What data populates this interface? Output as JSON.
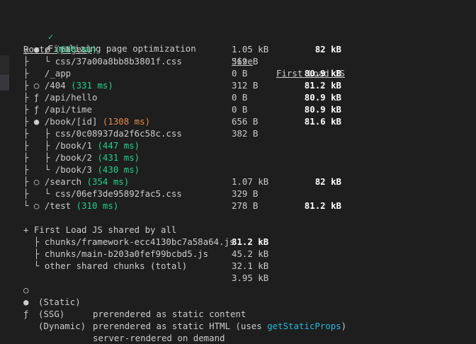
{
  "header": "Finalizing page optimization",
  "columns": {
    "route": "Route (pages)",
    "size": "Size",
    "first_load": "First Load JS"
  },
  "rows": [
    {
      "prefix": "┌ ● / ",
      "time": "(620 ms)",
      "time_color": "green",
      "size": "1.05 kB",
      "first": "82 kB"
    },
    {
      "prefix": "├   └ css/37a00a8bb8b3801f.css",
      "size": "369 B",
      "first": ""
    },
    {
      "prefix": "├   /_app",
      "size": "0 B",
      "first": "80.9 kB"
    },
    {
      "prefix": "├ ○ /404 ",
      "time": "(331 ms)",
      "time_color": "green",
      "size": "312 B",
      "first": "81.2 kB"
    },
    {
      "prefix": "├ ƒ /api/hello",
      "size": "0 B",
      "first": "80.9 kB"
    },
    {
      "prefix": "├ ƒ /api/time",
      "size": "0 B",
      "first": "80.9 kB"
    },
    {
      "prefix": "├ ● /book/[id] ",
      "time": "(1308 ms)",
      "time_color": "orange",
      "size": "656 B",
      "first": "81.6 kB"
    },
    {
      "prefix": "├   ├ css/0c08937da2f6c58c.css",
      "size": "382 B",
      "first": ""
    },
    {
      "prefix": "├   ├ /book/1 ",
      "time": "(447 ms)",
      "time_color": "green",
      "size": "",
      "first": ""
    },
    {
      "prefix": "├   ├ /book/2 ",
      "time": "(431 ms)",
      "time_color": "green",
      "size": "",
      "first": ""
    },
    {
      "prefix": "├   └ /book/3 ",
      "time": "(430 ms)",
      "time_color": "green",
      "size": "",
      "first": ""
    },
    {
      "prefix": "├ ○ /search ",
      "time": "(354 ms)",
      "time_color": "green",
      "size": "1.07 kB",
      "first": "82 kB"
    },
    {
      "prefix": "├   └ css/06ef3de95892fac5.css",
      "size": "329 B",
      "first": ""
    },
    {
      "prefix": "└ ○ /test ",
      "time": "(310 ms)",
      "time_color": "green",
      "size": "278 B",
      "first": "81.2 kB"
    }
  ],
  "shared": {
    "title": "+ First Load JS shared by all",
    "total": "81.2 kB",
    "items": [
      {
        "name": "  ├ chunks/framework-ecc4130bc7a58a64.js",
        "size": "45.2 kB"
      },
      {
        "name": "  ├ chunks/main-b203a0fef99bcbd5.js",
        "size": "32.1 kB"
      },
      {
        "name": "  └ other shared chunks (total)",
        "size": "3.95 kB"
      }
    ]
  },
  "legend": [
    {
      "symbol": "○",
      "label": "(Static)",
      "desc": "prerendered as static content"
    },
    {
      "symbol": "●",
      "label": "(SSG)",
      "desc": "prerendered as static HTML (uses ",
      "link": "getStaticProps",
      "tail": ")"
    },
    {
      "symbol": "ƒ",
      "label": "(Dynamic)",
      "desc": "server-rendered on demand"
    }
  ],
  "colors": {
    "green": "#23d18b",
    "orange": "#e5894b",
    "link": "#29b8db"
  }
}
